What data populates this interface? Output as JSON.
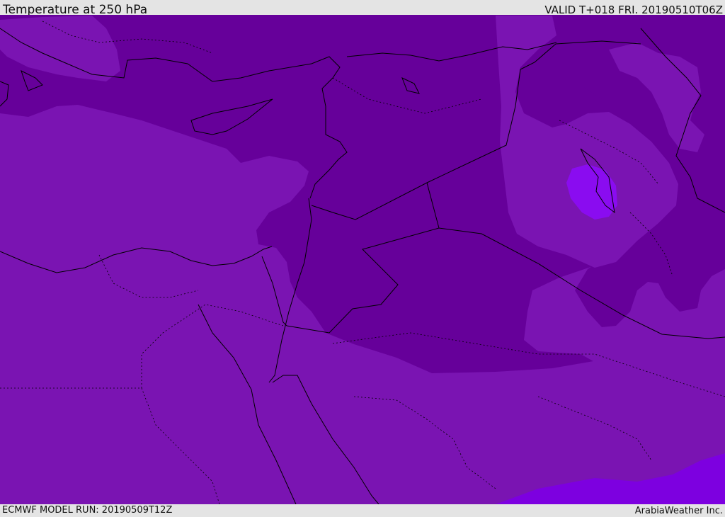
{
  "header": {
    "title": "Temperature at 250 hPa",
    "valid": "VALID T+018 FRI. 20190510T06Z"
  },
  "footer": {
    "model_run": "ECMWF MODEL RUN: 20190509T12Z",
    "credit": "ArabiaWeather Inc."
  },
  "colors": {
    "background_zone": "#7a14b2",
    "dark_zone": "#66009a",
    "bright_zone": "#7d00e0",
    "cold_spot": "#8a0cf0",
    "coastline": "#000000",
    "frame": "#e4e4e4"
  }
}
